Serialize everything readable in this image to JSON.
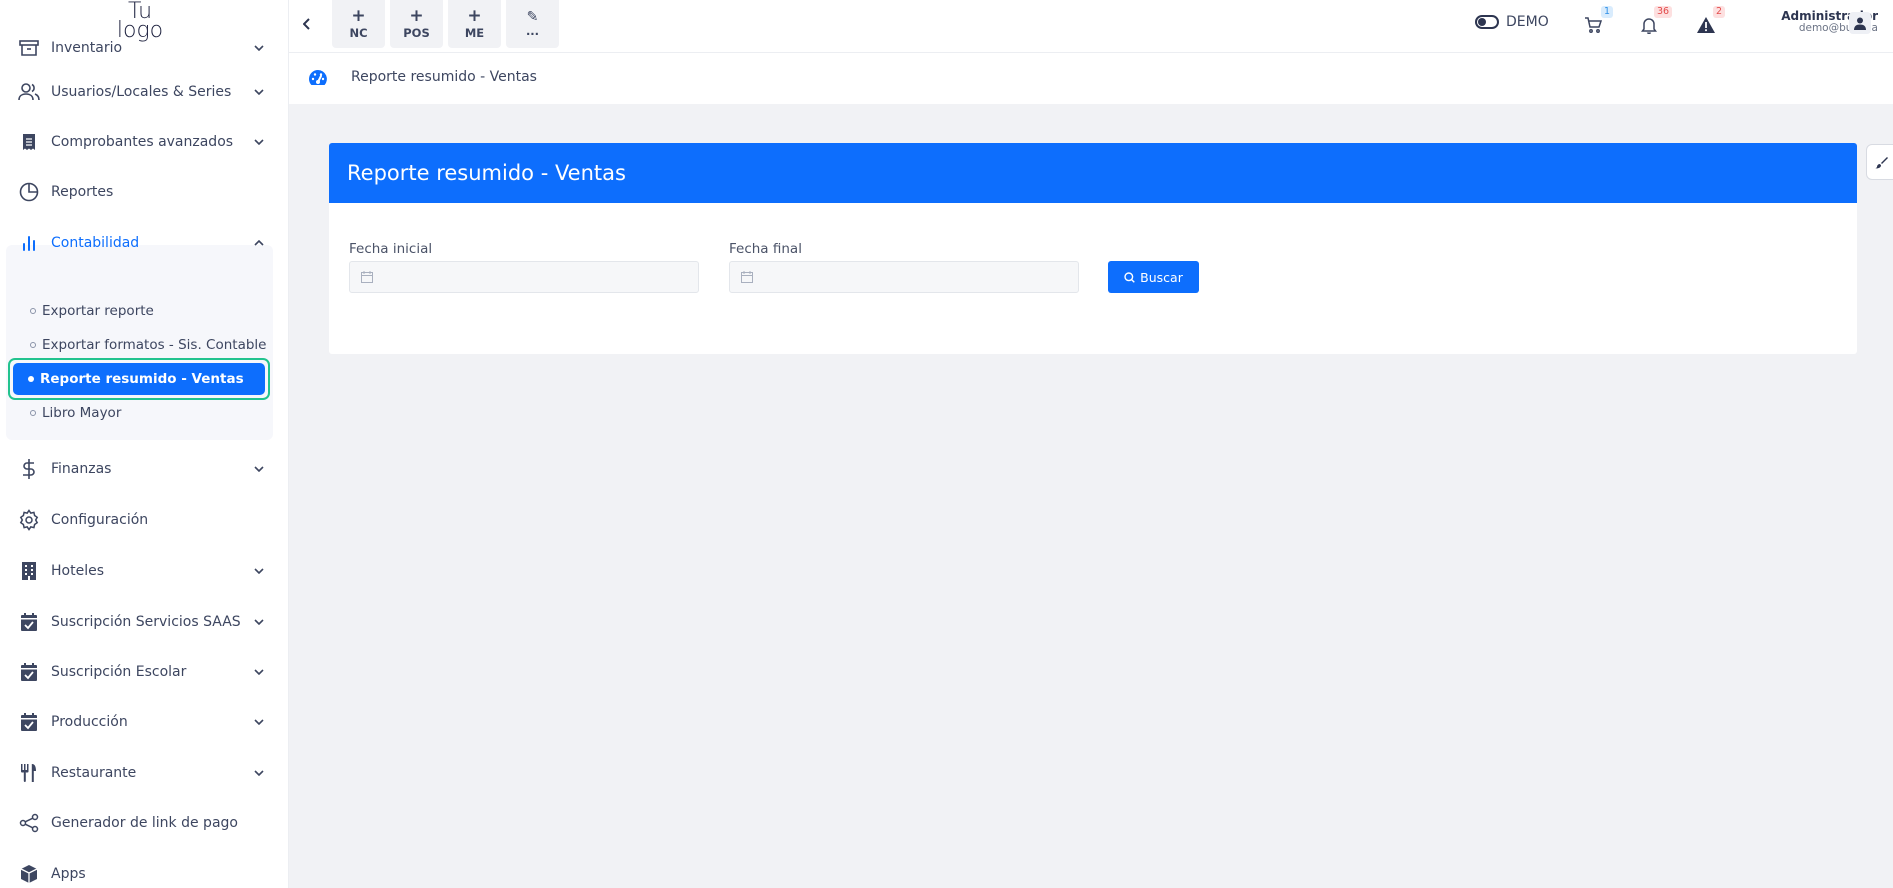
{
  "logo": {
    "line1": "Tu",
    "line2": "logo"
  },
  "sidebar": {
    "items": [
      {
        "label": "Inventario",
        "icon": "archive-icon"
      },
      {
        "label": "Usuarios/Locales & Series",
        "icon": "users-icon"
      },
      {
        "label": "Comprobantes avanzados",
        "icon": "receipt-icon"
      },
      {
        "label": "Reportes",
        "icon": "pie-chart-icon"
      },
      {
        "label": "Contabilidad",
        "icon": "bar-chart-icon"
      },
      {
        "label": "Finanzas",
        "icon": "dollar-icon"
      },
      {
        "label": "Configuración",
        "icon": "gear-icon"
      },
      {
        "label": "Hoteles",
        "icon": "building-icon"
      },
      {
        "label": "Suscripción Servicios SAAS",
        "icon": "calendar-check-icon"
      },
      {
        "label": "Suscripción Escolar",
        "icon": "calendar-check-icon"
      },
      {
        "label": "Producción",
        "icon": "calendar-check-icon"
      },
      {
        "label": "Restaurante",
        "icon": "utensils-icon"
      },
      {
        "label": "Generador de link de pago",
        "icon": "share-icon"
      },
      {
        "label": "Apps",
        "icon": "box-icon"
      }
    ],
    "contabilidad_sub": [
      {
        "label": "Exportar reporte"
      },
      {
        "label": "Exportar formatos - Sis. Contable"
      },
      {
        "label": "Reporte resumido - Ventas",
        "active": true
      },
      {
        "label": "Libro Mayor"
      }
    ]
  },
  "topbar": {
    "quick": [
      {
        "symbol": "+",
        "label": "NC"
      },
      {
        "symbol": "+",
        "label": "POS"
      },
      {
        "symbol": "+",
        "label": "ME"
      },
      {
        "symbol": "✎",
        "label": "..."
      }
    ],
    "demo_label": "DEMO",
    "cart_badge": "1",
    "bell_badge": "36",
    "alert_badge": "2",
    "user_name": "Administrador",
    "user_email": "demo@buho.la"
  },
  "breadcrumb": {
    "text": "Reporte resumido - Ventas"
  },
  "card": {
    "title": "Reporte resumido - Ventas",
    "fecha_inicial_label": "Fecha inicial",
    "fecha_final_label": "Fecha final",
    "buscar_label": "Buscar"
  },
  "colors": {
    "primary": "#0d6efd",
    "highlight": "#22c38e",
    "badge_red": "#e34b4b",
    "badge_blue": "#2f8fe6"
  }
}
